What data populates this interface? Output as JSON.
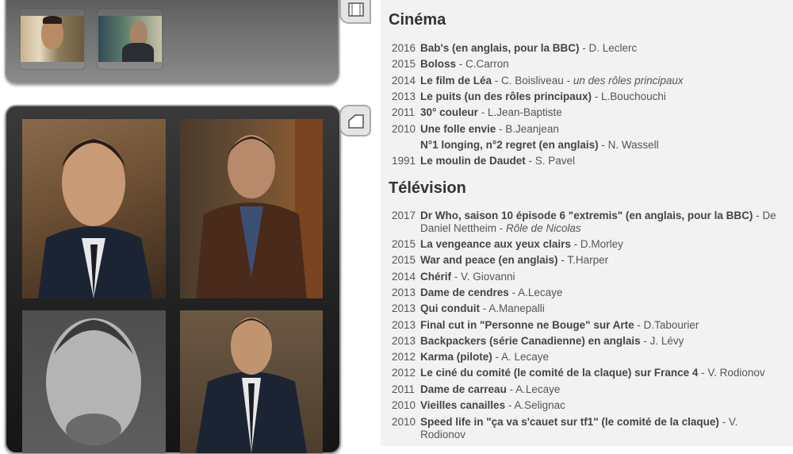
{
  "cinema": {
    "heading": "Cinéma",
    "entries": [
      {
        "year": "2016",
        "title": "Bab's (en anglais, pour la BBC)",
        "director": " - D. Leclerc",
        "note": ""
      },
      {
        "year": "2015",
        "title": "Boloss",
        "director": " - C.Carron",
        "note": ""
      },
      {
        "year": "2014",
        "title": "Le film de Léa",
        "director": " - C. Boisliveau - ",
        "note": "un des rôles principaux"
      },
      {
        "year": "2013",
        "title": "Le puits (un des rôles principaux)",
        "director": " - L.Bouchouchi",
        "note": ""
      },
      {
        "year": "2011",
        "title": "30° couleur",
        "director": " - L.Jean-Baptiste",
        "note": ""
      },
      {
        "year": "2010",
        "title": "Une folle envie",
        "director": " - B.Jeanjean",
        "note": ""
      },
      {
        "year": "",
        "title": "N°1 longing, n°2 regret (en anglais)",
        "director": " - N. Wassell",
        "note": ""
      },
      {
        "year": "1991",
        "title": "Le moulin de Daudet",
        "director": " - S. Pavel",
        "note": ""
      }
    ]
  },
  "television": {
    "heading": "Télévision",
    "entries": [
      {
        "year": "2017",
        "title": "Dr Who, saison 10 épisode 6 \"extremis\" (en anglais, pour la BBC)",
        "director": " - De",
        "cont": "Daniel Nettheim - ",
        "note": "Rôle de Nicolas"
      },
      {
        "year": "2015",
        "title": "La vengeance aux yeux clairs",
        "director": " - D.Morley",
        "note": ""
      },
      {
        "year": "2015",
        "title": "War and peace (en anglais)",
        "director": " - T.Harper",
        "note": ""
      },
      {
        "year": "2014",
        "title": "Chérif",
        "director": " - V. Giovanni",
        "note": ""
      },
      {
        "year": "2013",
        "title": "Dame de cendres",
        "director": " - A.Lecaye",
        "note": ""
      },
      {
        "year": "2013",
        "title": "Qui conduit",
        "director": " - A.Manepalli",
        "note": ""
      },
      {
        "year": "2013",
        "title": "Final cut in \"Personne ne Bouge\" sur Arte",
        "director": " - D.Tabourier",
        "note": ""
      },
      {
        "year": "2013",
        "title": "Backpackers (série Canadienne) en anglais",
        "director": " - J. Lévy",
        "note": ""
      },
      {
        "year": "2012",
        "title": "Karma (pilote)",
        "director": " - A. Lecaye",
        "note": ""
      },
      {
        "year": "2012",
        "title": "Le ciné du comité (le comité de la claque) sur France 4",
        "director": " - V. Rodionov",
        "note": ""
      },
      {
        "year": "2011",
        "title": "Dame de carreau",
        "director": " - A.Lecaye",
        "note": ""
      },
      {
        "year": "2010",
        "title": "Vieilles canailles",
        "director": " - A.Selignac",
        "note": ""
      },
      {
        "year": "2010",
        "title": "Speed life in \"ça va s'cauet sur tf1\" (le comité de la claque)",
        "director": " - V.",
        "cont": "Rodionov",
        "note": ""
      }
    ]
  },
  "icons": {
    "video_tab": "film-strip-icon",
    "photo_tab": "photo-stack-icon"
  }
}
